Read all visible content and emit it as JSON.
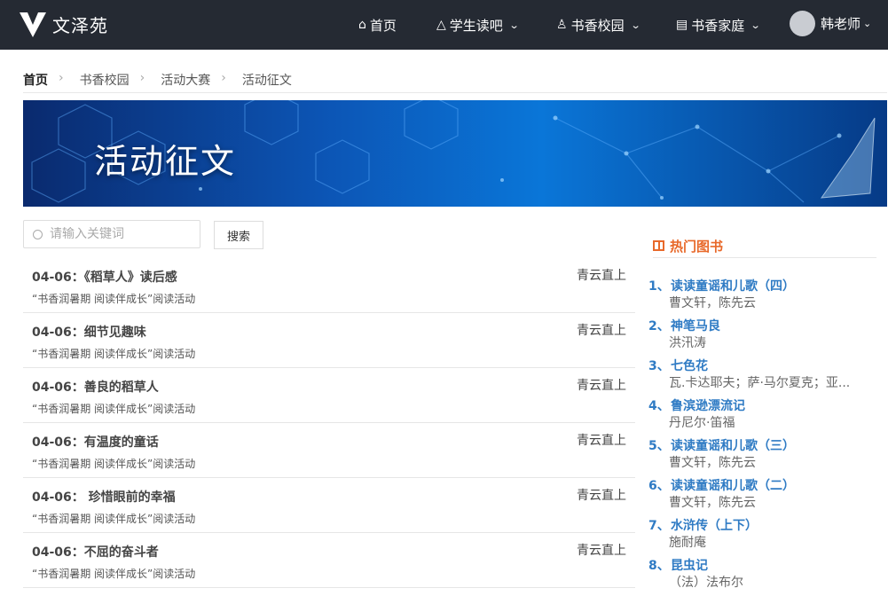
{
  "app": {
    "name": "文泽苑"
  },
  "nav": {
    "home": "首页",
    "student": "学生读吧",
    "campus": "书香校园",
    "family": "书香家庭",
    "user": "韩老师"
  },
  "breadcrumb": [
    "首页",
    "书香校园",
    "活动大赛",
    "活动征文"
  ],
  "banner": {
    "title": "活动征文"
  },
  "search": {
    "placeholder": "请输入关键词",
    "button": "搜索"
  },
  "articles": [
    {
      "title": "04-06：《稻草人》读后感",
      "subtitle": "“书香润暑期 阅读伴成长”阅读活动",
      "author": "青云直上"
    },
    {
      "title": "04-06：细节见趣味",
      "subtitle": "“书香润暑期 阅读伴成长”阅读活动",
      "author": "青云直上"
    },
    {
      "title": "04-06：善良的稻草人",
      "subtitle": "“书香润暑期 阅读伴成长”阅读活动",
      "author": "青云直上"
    },
    {
      "title": "04-06：有温度的童话",
      "subtitle": "“书香润暑期 阅读伴成长”阅读活动",
      "author": "青云直上"
    },
    {
      "title": "04-06： 珍惜眼前的幸福",
      "subtitle": "“书香润暑期 阅读伴成长”阅读活动",
      "author": "青云直上"
    },
    {
      "title": "04-06：不屈的奋斗者",
      "subtitle": "“书香润暑期 阅读伴成长”阅读活动",
      "author": "青云直上"
    }
  ],
  "hot": {
    "heading": "热门图书",
    "books": [
      {
        "num": "1、",
        "title": "读读童谣和儿歌（四）",
        "author": "曹文轩，陈先云"
      },
      {
        "num": "2、",
        "title": "神笔马良",
        "author": "洪汛涛"
      },
      {
        "num": "3、",
        "title": "七色花",
        "author": "瓦.卡达耶夫；萨·马尔夏克；亚..."
      },
      {
        "num": "4、",
        "title": "鲁滨逊漂流记",
        "author": "丹尼尔·笛福"
      },
      {
        "num": "5、",
        "title": "读读童谣和儿歌（三）",
        "author": "曹文轩，陈先云"
      },
      {
        "num": "6、",
        "title": "读读童谣和儿歌（二）",
        "author": "曹文轩，陈先云"
      },
      {
        "num": "7、",
        "title": "水浒传（上下）",
        "author": "施耐庵"
      },
      {
        "num": "8、",
        "title": "昆虫记",
        "author": "（法）法布尔"
      }
    ]
  }
}
